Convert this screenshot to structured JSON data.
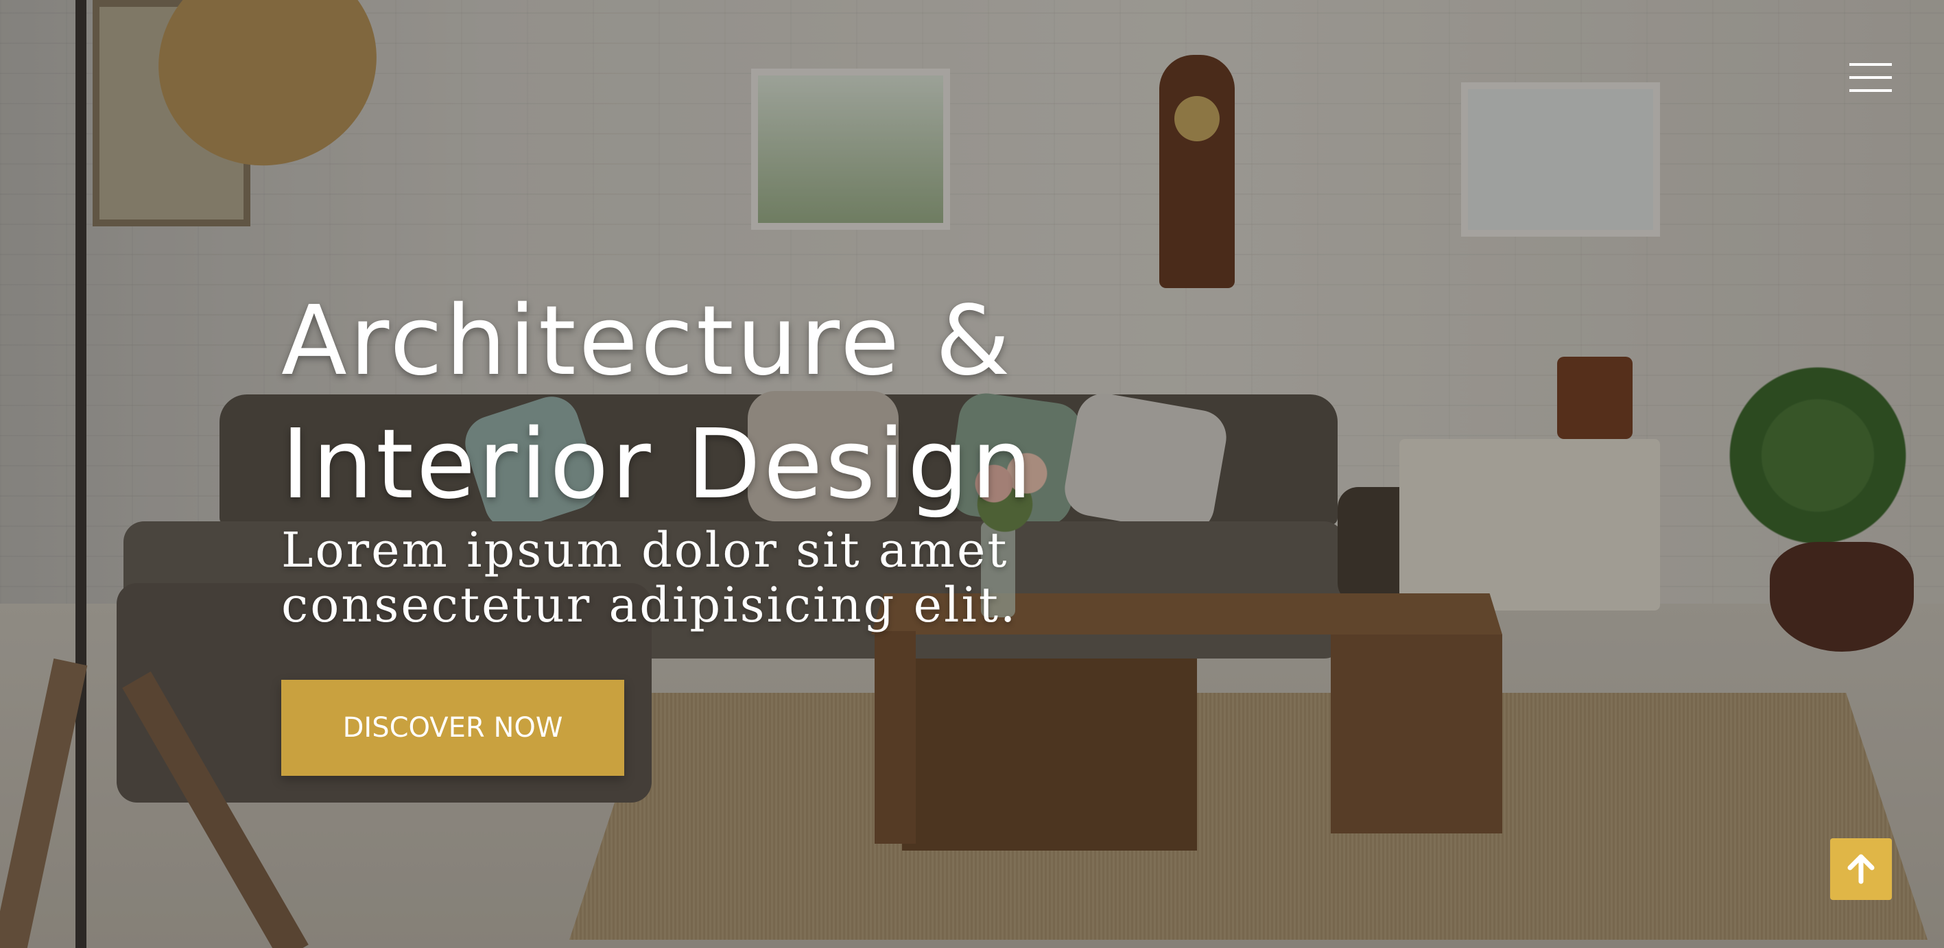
{
  "header": {
    "menu_icon": "hamburger-menu-icon"
  },
  "hero": {
    "title_line1": "Architecture &",
    "title_line2": "Interior Design",
    "subtitle": "Lorem ipsum dolor sit amet consectetur adipisicing elit.",
    "cta_label": "DISCOVER NOW"
  },
  "scroll_top": {
    "icon": "arrow-up-icon"
  },
  "colors": {
    "accent": "#c9a13f",
    "scroll_top_bg": "#e0b647",
    "text": "#ffffff"
  }
}
